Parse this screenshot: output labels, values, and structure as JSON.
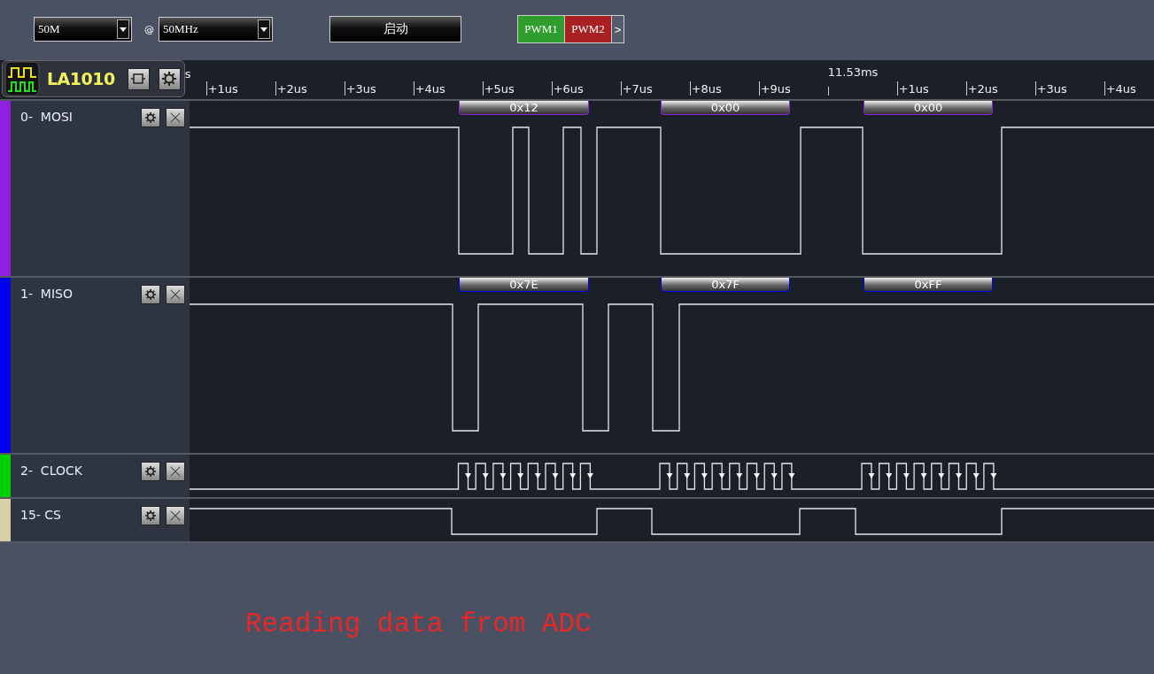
{
  "toolbar": {
    "sample_depth": "50M",
    "at": "@",
    "sample_rate": "50MHz",
    "start_button": "启动",
    "pwm": [
      {
        "label": "PWM1",
        "color": "#2e9e2e"
      },
      {
        "label": "PWM2",
        "color": "#a82020"
      }
    ],
    "more": ">"
  },
  "device": {
    "name": "LA1010"
  },
  "ruler": {
    "cut_label": "s",
    "ticks": [
      {
        "kind": "tick",
        "label": "+1us"
      },
      {
        "kind": "tick",
        "label": "+2us"
      },
      {
        "kind": "tick",
        "label": "+3us"
      },
      {
        "kind": "tick",
        "label": "+4us"
      },
      {
        "kind": "tick",
        "label": "+5us"
      },
      {
        "kind": "tick",
        "label": "+6us"
      },
      {
        "kind": "tick",
        "label": "+7us"
      },
      {
        "kind": "tick",
        "label": "+8us"
      },
      {
        "kind": "tick",
        "label": "+9us"
      },
      {
        "kind": "marker",
        "label": "11.53ms"
      },
      {
        "kind": "tick",
        "label": "+1us"
      },
      {
        "kind": "tick",
        "label": "+2us"
      },
      {
        "kind": "tick",
        "label": "+3us"
      },
      {
        "kind": "tick",
        "label": "+4us"
      }
    ]
  },
  "channels": [
    {
      "label": "0-  MOSI",
      "color": "#9020e0",
      "frames": [
        "0x12",
        "0x00",
        "0x00"
      ]
    },
    {
      "label": "1-  MISO",
      "color": "#0000f0",
      "frames": [
        "0x7E",
        "0x7F",
        "0xFF"
      ]
    },
    {
      "label": "2-  CLOCK",
      "color": "#00d000"
    },
    {
      "label": "15- CS",
      "color": "#d8d0a8"
    }
  ],
  "caption": "Reading data from ADC"
}
